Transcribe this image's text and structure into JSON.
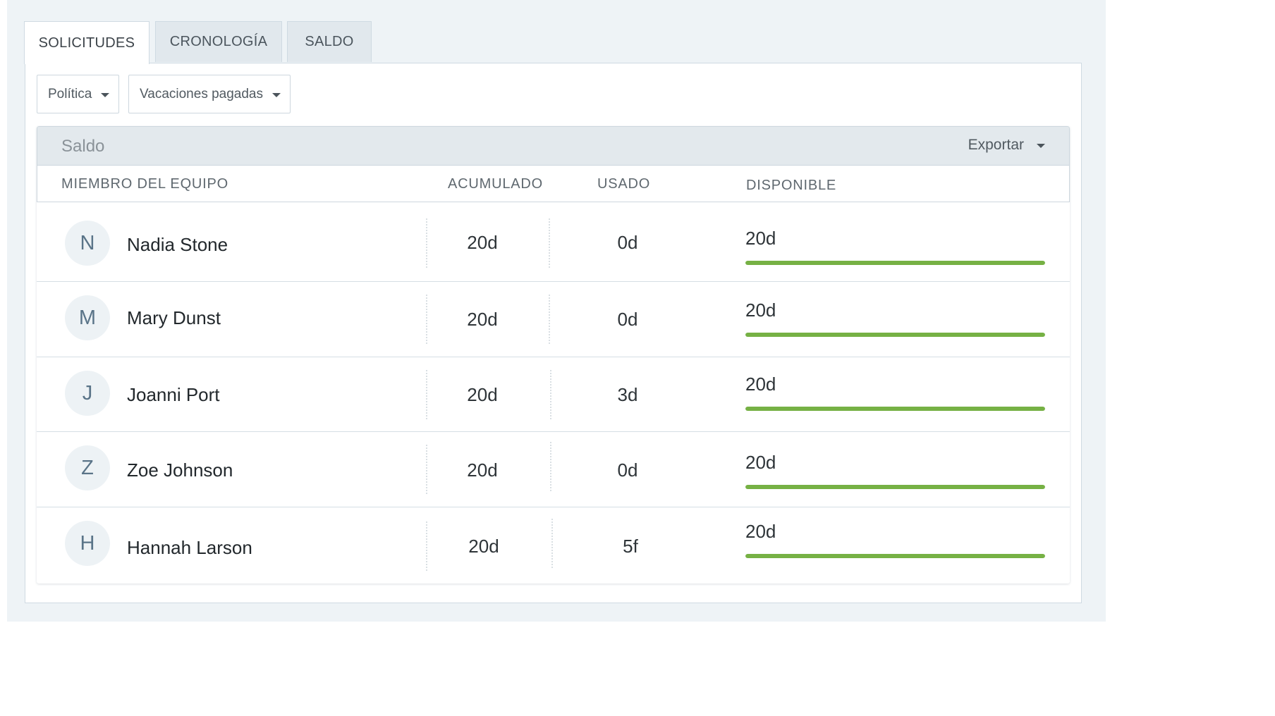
{
  "tabs": [
    {
      "label": "SOLICITUDES",
      "active": true
    },
    {
      "label": "CRONOLOGÍA",
      "active": false
    },
    {
      "label": "SALDO",
      "active": false
    }
  ],
  "filters": {
    "policy": {
      "label": "Política"
    },
    "type": {
      "label": "Vacaciones pagadas"
    }
  },
  "card": {
    "title": "Saldo",
    "export_label": "Exportar"
  },
  "columns": {
    "member": "MIEMBRO DEL EQUIPO",
    "accrued": "ACUMULADO",
    "used": "USADO",
    "available": "DISPONIBLE"
  },
  "rows": [
    {
      "initial": "N",
      "name": "Nadia Stone",
      "accrued": "20d",
      "used": "0d",
      "available": "20d",
      "available_fraction": 1.0
    },
    {
      "initial": "M",
      "name": "Mary Dunst",
      "accrued": "20d",
      "used": "0d",
      "available": "20d",
      "available_fraction": 1.0
    },
    {
      "initial": "J",
      "name": "Joanni Port",
      "accrued": "20d",
      "used": "3d",
      "available": "20d",
      "available_fraction": 1.0
    },
    {
      "initial": "Z",
      "name": "Zoe Johnson",
      "accrued": "20d",
      "used": "0d",
      "available": "20d",
      "available_fraction": 1.0
    },
    {
      "initial": "H",
      "name": "Hannah Larson",
      "accrued": "20d",
      "used": "5f",
      "available": "20d",
      "available_fraction": 1.0
    }
  ],
  "colors": {
    "bar_fill": "#76b144",
    "avatar_text": "#5a7488",
    "panel_bg": "#eef3f6"
  }
}
